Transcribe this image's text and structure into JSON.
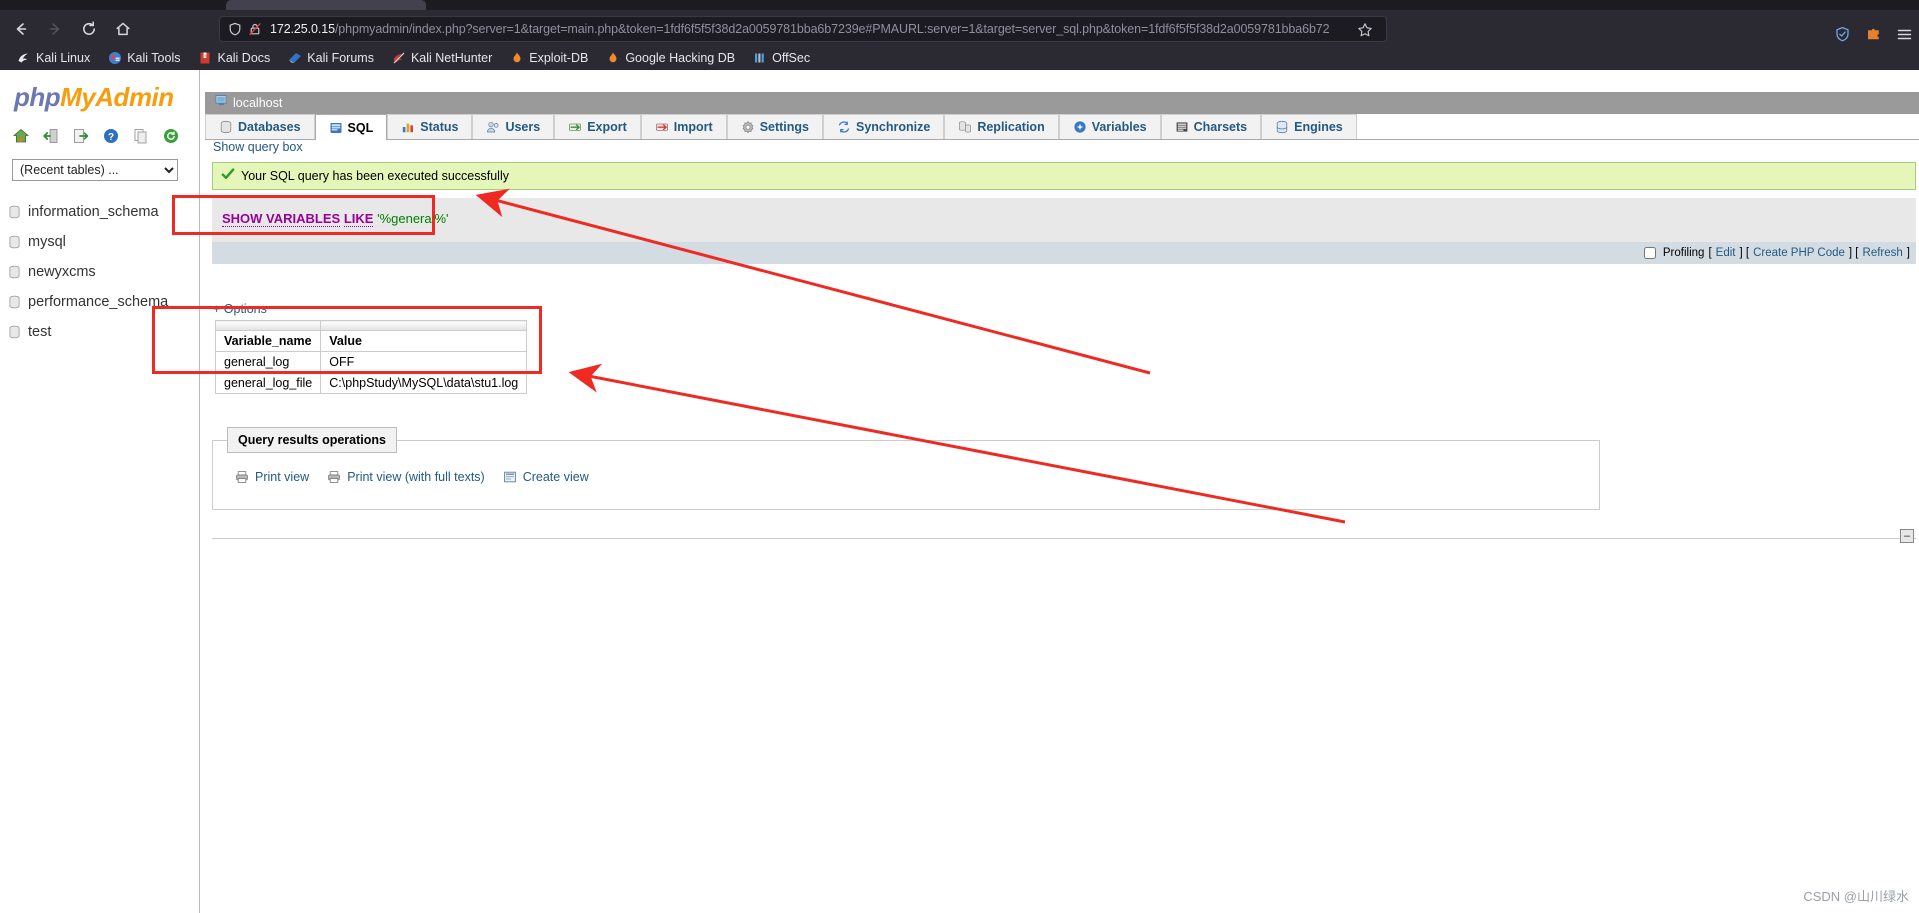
{
  "browser": {
    "nav": {
      "back": "back-arrow",
      "forward": "forward-arrow",
      "reload": "reload",
      "home": "home"
    },
    "url": {
      "host": "172.25.0.15",
      "path": "/phpmyadmin/index.php?server=1&target=main.php&token=1fdf6f5f5f38d2a0059781bba6b7239e#PMAURL:server=1&target=server_sql.php&token=1fdf6f5f5f38d2a0059781bba6b72",
      "full": "172.25.0.15/phpmyadmin/index.php?server=1&target=main.php&token=1fdf6f5f5f38d2a0059781bba6b7239e#PMAURL:server=1&target=server_sql.php&token=1fdf6f5f5f38d2a0059781bba6b72",
      "shield_icon": "shield-icon",
      "lock_icon": "lock-crossed-icon",
      "bookmark_icon": "star-icon"
    },
    "bookmarks": [
      {
        "label": "Kali Linux",
        "icon": "kali-dragon-icon"
      },
      {
        "label": "Kali Tools",
        "icon": "kali-tools-icon"
      },
      {
        "label": "Kali Docs",
        "icon": "kali-docs-icon"
      },
      {
        "label": "Kali Forums",
        "icon": "kali-forums-icon"
      },
      {
        "label": "Kali NetHunter",
        "icon": "kali-nethunter-icon"
      },
      {
        "label": "Exploit-DB",
        "icon": "exploit-db-icon"
      },
      {
        "label": "Google Hacking DB",
        "icon": "google-hacking-db-icon"
      },
      {
        "label": "OffSec",
        "icon": "offsec-icon"
      }
    ],
    "toolbar_right": [
      {
        "name": "shield-extension-icon"
      },
      {
        "name": "extensions-puzzle-icon"
      },
      {
        "name": "app-menu-icon"
      }
    ]
  },
  "sidebar": {
    "logo": {
      "php": "php",
      "my": "My",
      "admin": "Admin"
    },
    "nav_icons": [
      {
        "name": "home-icon"
      },
      {
        "name": "logout-icon"
      },
      {
        "name": "query-window-icon"
      },
      {
        "name": "help-docs-icon"
      },
      {
        "name": "copy-icon"
      },
      {
        "name": "reload-navigation-icon"
      }
    ],
    "recent_select": {
      "value": "(Recent tables) ...",
      "options": [
        "(Recent tables) ..."
      ]
    },
    "databases": [
      {
        "name": "information_schema",
        "icon": "database-icon"
      },
      {
        "name": "mysql",
        "icon": "database-icon"
      },
      {
        "name": "newyxcms",
        "icon": "database-icon"
      },
      {
        "name": "performance_schema",
        "icon": "database-icon"
      },
      {
        "name": "test",
        "icon": "database-icon"
      }
    ]
  },
  "main": {
    "server_label": "localhost",
    "server_icon": "server-icon",
    "tabs": [
      {
        "label": "Databases",
        "icon": "databases-icon",
        "active": false
      },
      {
        "label": "SQL",
        "icon": "sql-icon",
        "active": true
      },
      {
        "label": "Status",
        "icon": "status-icon",
        "active": false
      },
      {
        "label": "Users",
        "icon": "users-icon",
        "active": false
      },
      {
        "label": "Export",
        "icon": "export-icon",
        "active": false
      },
      {
        "label": "Import",
        "icon": "import-icon",
        "active": false
      },
      {
        "label": "Settings",
        "icon": "settings-icon",
        "active": false
      },
      {
        "label": "Synchronize",
        "icon": "synchronize-icon",
        "active": false
      },
      {
        "label": "Replication",
        "icon": "replication-icon",
        "active": false
      },
      {
        "label": "Variables",
        "icon": "variables-icon",
        "active": false
      },
      {
        "label": "Charsets",
        "icon": "charsets-icon",
        "active": false
      },
      {
        "label": "Engines",
        "icon": "engines-icon",
        "active": false
      }
    ],
    "show_query_box": "Show query box",
    "success_message": "Your SQL query has been executed successfully",
    "success_icon": "green-check-icon",
    "sql": {
      "keyword1": "SHOW VARIABLES",
      "keyword2": "LIKE",
      "literal": "'%general%'"
    },
    "sql_footer": {
      "profiling_label": "Profiling",
      "profiling_checked": false,
      "open_bracket": "[",
      "edit": "Edit",
      "sep1": "] [",
      "create_php_code": "Create PHP Code",
      "sep2": "] [",
      "refresh": "Refresh",
      "close_bracket": "]"
    },
    "options_link": "+ Options",
    "results": {
      "columns": [
        "Variable_name",
        "Value"
      ],
      "rows": [
        [
          "general_log",
          "OFF"
        ],
        [
          "general_log_file",
          "C:\\phpStudy\\MySQL\\data\\stu1.log"
        ]
      ]
    },
    "query_results_operations": {
      "title": "Query results operations",
      "links": [
        {
          "label": "Print view",
          "icon": "print-icon"
        },
        {
          "label": "Print view (with full texts)",
          "icon": "print-full-icon"
        },
        {
          "label": "Create view",
          "icon": "create-view-icon"
        }
      ]
    },
    "collapse_button": "–"
  },
  "annotations": {
    "boxes": [
      {
        "name": "sql-query-highlight"
      },
      {
        "name": "results-table-highlight"
      }
    ],
    "arrows": [
      {
        "name": "arrow-to-sql-query"
      },
      {
        "name": "arrow-to-results-table"
      }
    ]
  },
  "watermark": "CSDN @山川绿水",
  "colors": {
    "accent_orange": "#f89d0e",
    "accent_blue": "#6c78af",
    "success_bg": "#e4f6b8",
    "annotation_red": "#ee2a23",
    "link_blue": "#235a81"
  }
}
